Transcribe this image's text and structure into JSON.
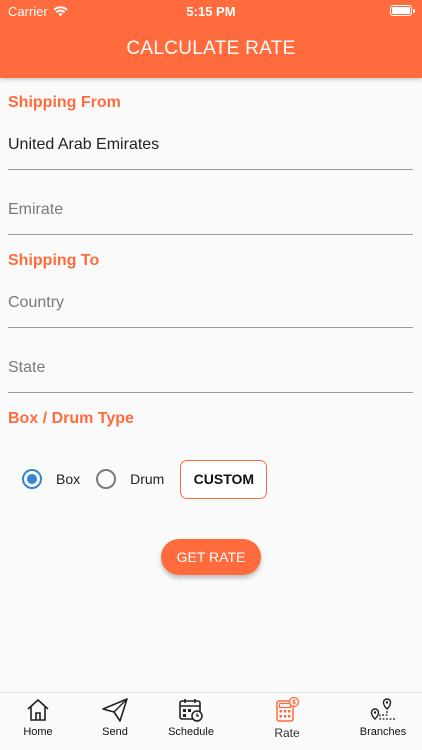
{
  "status": {
    "carrier": "Carrier",
    "time": "5:15 PM"
  },
  "header": {
    "title": "CALCULATE RATE"
  },
  "shipping_from": {
    "label": "Shipping From",
    "country_value": "United Arab Emirates",
    "emirate_placeholder": "Emirate"
  },
  "shipping_to": {
    "label": "Shipping To",
    "country_placeholder": "Country",
    "state_placeholder": "State"
  },
  "box_type": {
    "label": "Box / Drum Type",
    "options": [
      {
        "label": "Box",
        "selected": true
      },
      {
        "label": "Drum",
        "selected": false
      }
    ],
    "custom_label": "CUSTOM"
  },
  "get_rate_label": "GET RATE",
  "tabs": [
    {
      "label": "Home",
      "icon": "home-icon"
    },
    {
      "label": "Send",
      "icon": "send-icon"
    },
    {
      "label": "Schedule",
      "icon": "calendar-icon"
    },
    {
      "label": "Rate",
      "icon": "calculator-icon",
      "active": true
    },
    {
      "label": "Branches",
      "icon": "map-pin-icon"
    }
  ],
  "colors": {
    "accent": "#ff6b3d",
    "radio_selected": "#2f86d6"
  }
}
